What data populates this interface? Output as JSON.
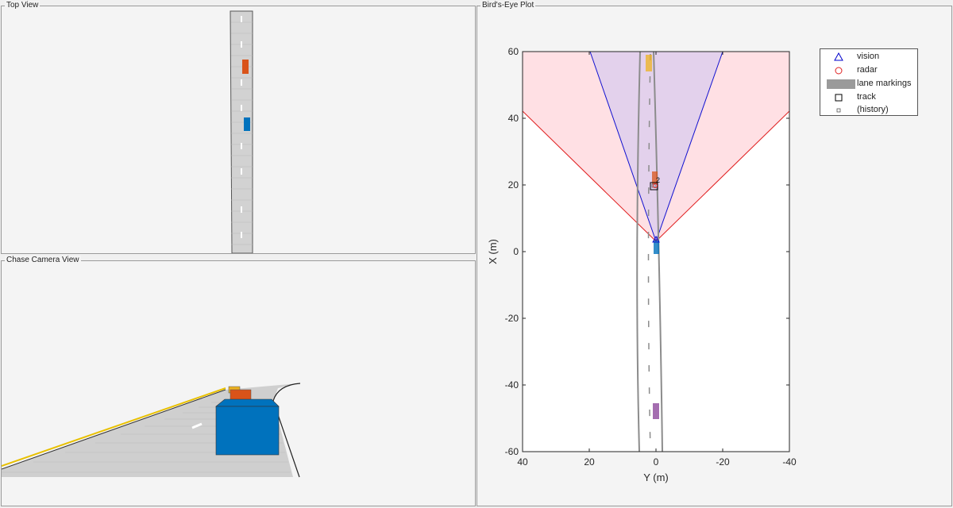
{
  "panels": {
    "top_view": {
      "title": "Top View"
    },
    "chase_view": {
      "title": "Chase Camera View"
    },
    "birds_eye": {
      "title": "Bird's-Eye Plot"
    }
  },
  "legend": {
    "items": [
      {
        "label": "vision",
        "symbol": "triangle",
        "color": "#0000cc"
      },
      {
        "label": "radar",
        "symbol": "circle",
        "color": "#e02020"
      },
      {
        "label": "lane markings",
        "symbol": "bar",
        "color": "#9a9a9a"
      },
      {
        "label": "track",
        "symbol": "square",
        "color": "#000000"
      },
      {
        "label": "(history)",
        "symbol": "small-square",
        "color": "#555555"
      }
    ]
  },
  "plot": {
    "xlabel": "Y (m)",
    "ylabel": "X (m)",
    "xticks": [
      "40",
      "20",
      "0",
      "-20",
      "-40"
    ],
    "yticks": [
      "60",
      "40",
      "20",
      "0",
      "-20",
      "-40",
      "-60"
    ],
    "track_id": "2"
  },
  "colors": {
    "ego": "#0072bd",
    "lead_red": "#d95319",
    "far_yellow": "#edb120",
    "rear_purple": "#7e2f8e",
    "radar_fill": "#ffe0e4",
    "vision_fill": "#e3d1ec"
  }
}
